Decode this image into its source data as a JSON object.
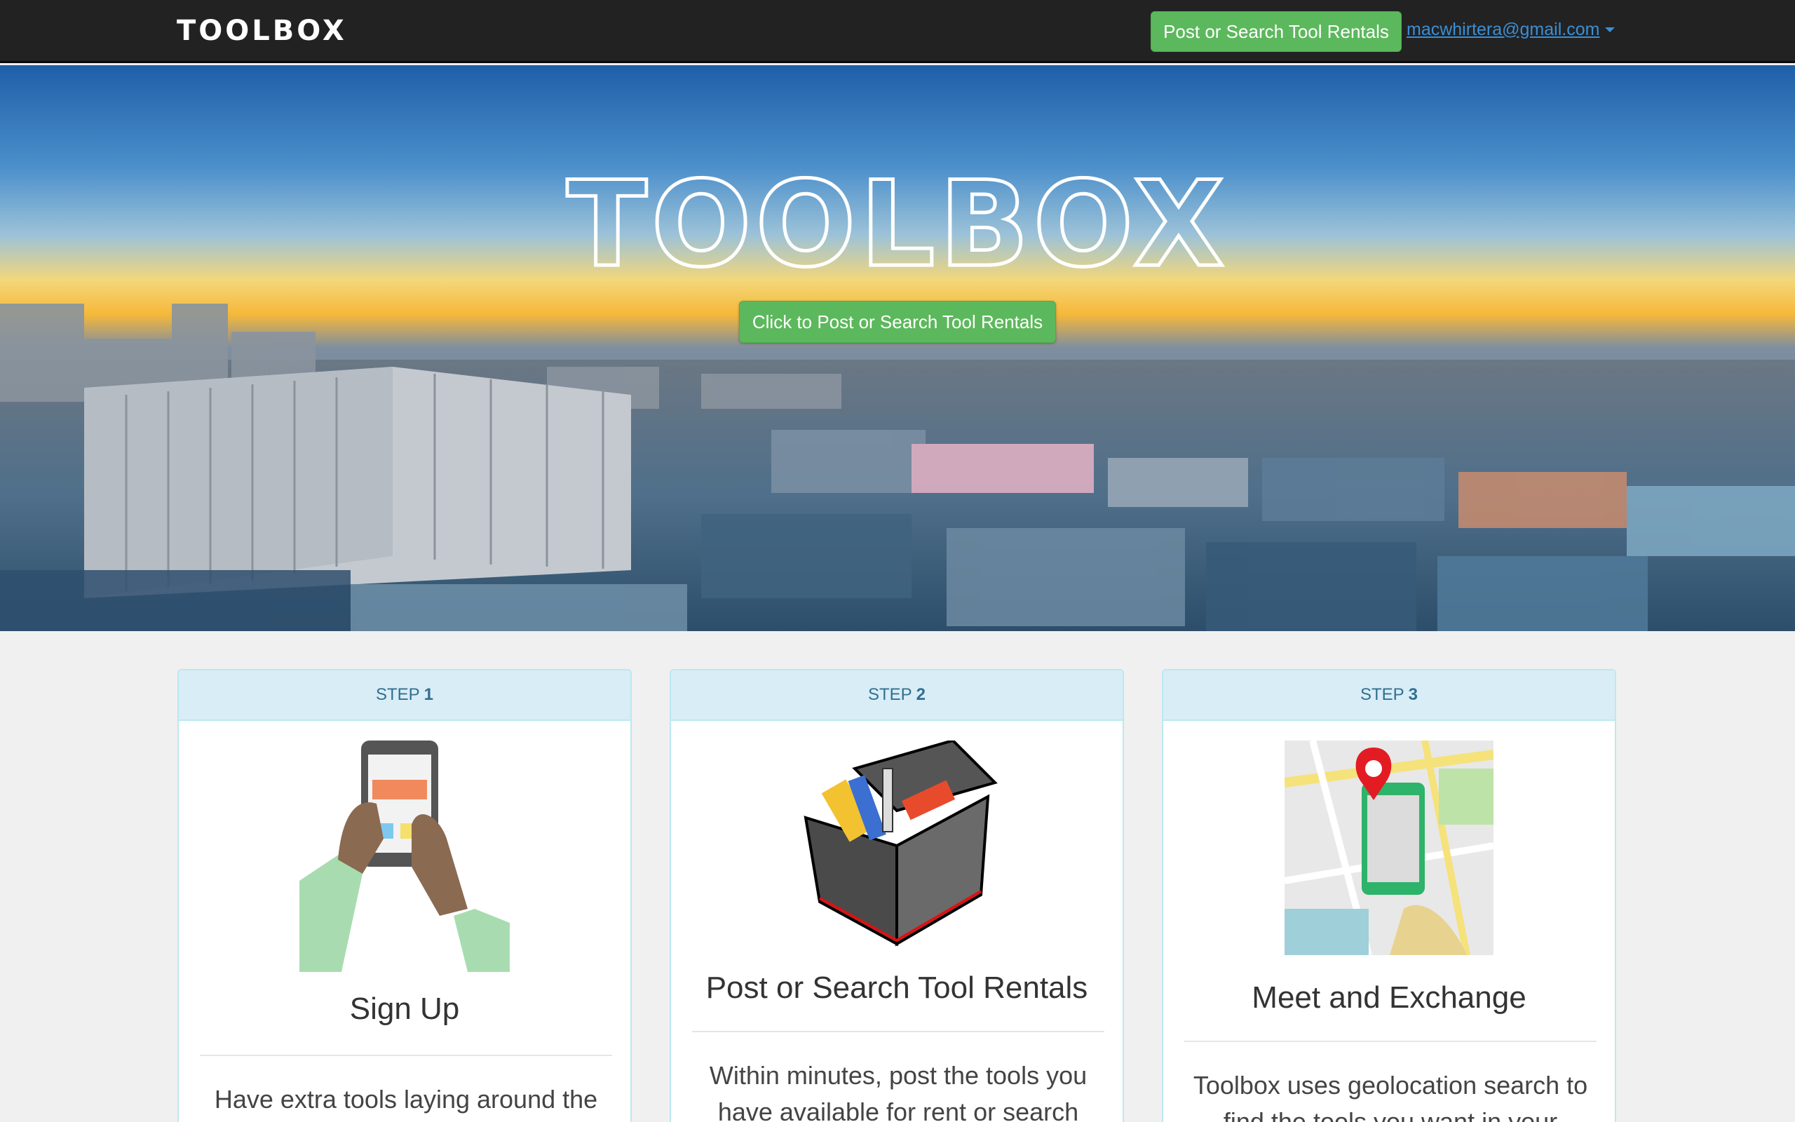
{
  "navbar": {
    "brand": "TOOLBOX",
    "cta_label": "Post or Search Tool Rentals",
    "user_email": "macwhirtera@gmail.com"
  },
  "hero": {
    "title": "TOOLBOX",
    "cta_label": "Click to Post or Search Tool Rentals"
  },
  "steps": [
    {
      "step_word": "STEP",
      "step_number": "1",
      "title": "Sign Up",
      "text": "Have extra tools laying around the"
    },
    {
      "step_word": "STEP",
      "step_number": "2",
      "title": "Post or Search Tool Rentals",
      "text": "Within minutes, post the tools you have available for rent or search"
    },
    {
      "step_word": "STEP",
      "step_number": "3",
      "title": "Meet and Exchange",
      "text": "Toolbox uses geolocation search to find the tools you want in your"
    }
  ],
  "colors": {
    "navbar_bg": "#222222",
    "button_green": "#5cb85c",
    "link_blue": "#3a8fd6",
    "panel_heading_bg": "#d9edf7",
    "panel_heading_text": "#31708f",
    "page_bg": "#f0f0f0"
  },
  "icons": {
    "user_menu_caret": "caret-down-icon",
    "step1_image": "hands-holding-phone-illustration",
    "step2_image": "toolbox-with-tools-illustration",
    "step3_image": "map-location-pin-phone-illustration"
  }
}
